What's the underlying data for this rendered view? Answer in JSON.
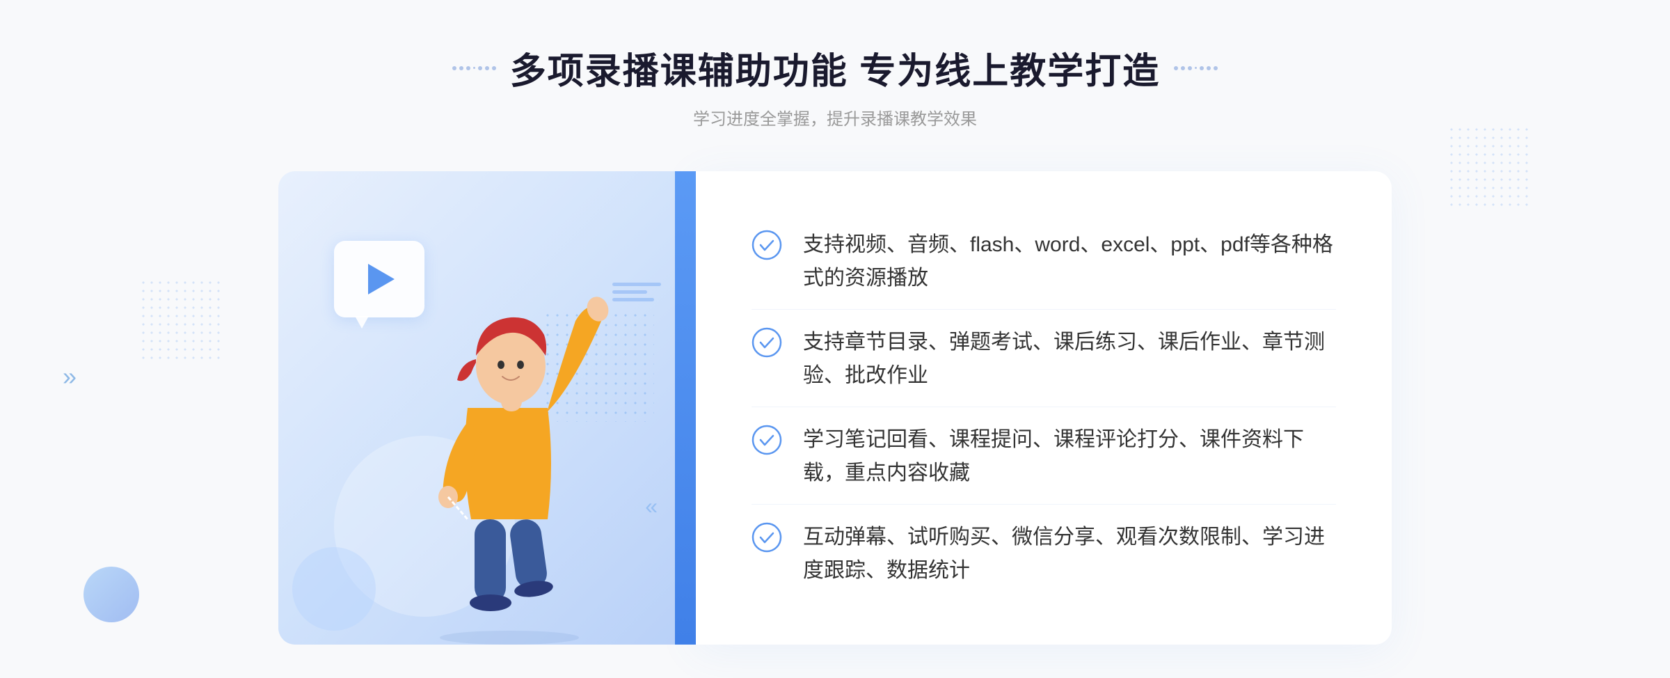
{
  "header": {
    "title": "多项录播课辅助功能 专为线上教学打造",
    "subtitle": "学习进度全掌握，提升录播课教学效果"
  },
  "features": [
    {
      "id": "feature-1",
      "text": "支持视频、音频、flash、word、excel、ppt、pdf等各种格式的资源播放"
    },
    {
      "id": "feature-2",
      "text": "支持章节目录、弹题考试、课后练习、课后作业、章节测验、批改作业"
    },
    {
      "id": "feature-3",
      "text": "学习笔记回看、课程提问、课程评论打分、课件资料下载，重点内容收藏"
    },
    {
      "id": "feature-4",
      "text": "互动弹幕、试听购买、微信分享、观看次数限制、学习进度跟踪、数据统计"
    }
  ],
  "colors": {
    "accent_blue": "#4a80e8",
    "light_blue": "#7ab5f5",
    "check_color": "#5a96f0"
  }
}
